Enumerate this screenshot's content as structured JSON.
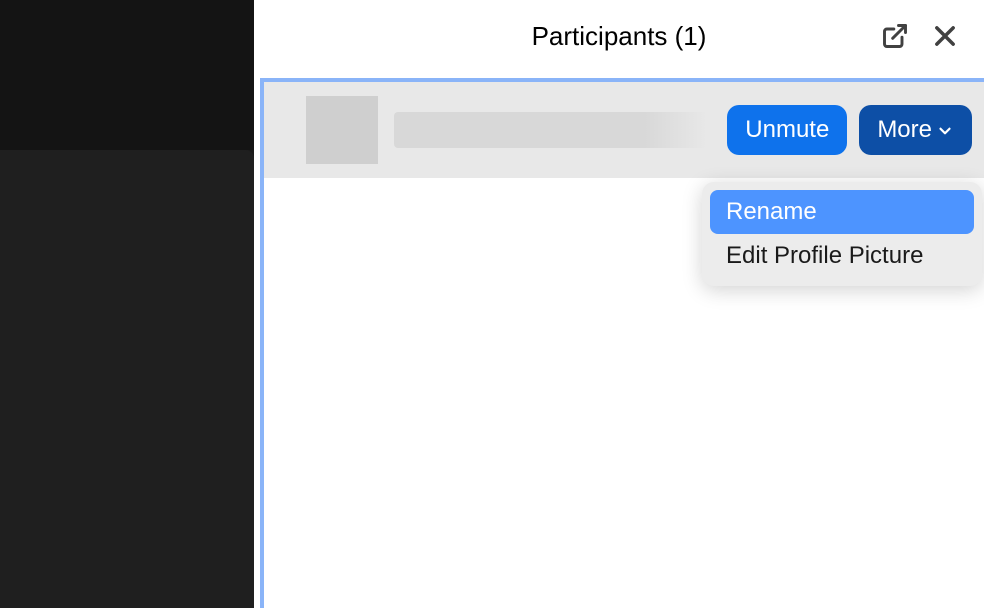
{
  "header": {
    "title": "Participants (1)"
  },
  "participant": {
    "unmute_label": "Unmute",
    "more_label": "More"
  },
  "dropdown": {
    "items": [
      {
        "label": "Rename",
        "highlighted": true
      },
      {
        "label": "Edit Profile Picture",
        "highlighted": false
      }
    ]
  }
}
